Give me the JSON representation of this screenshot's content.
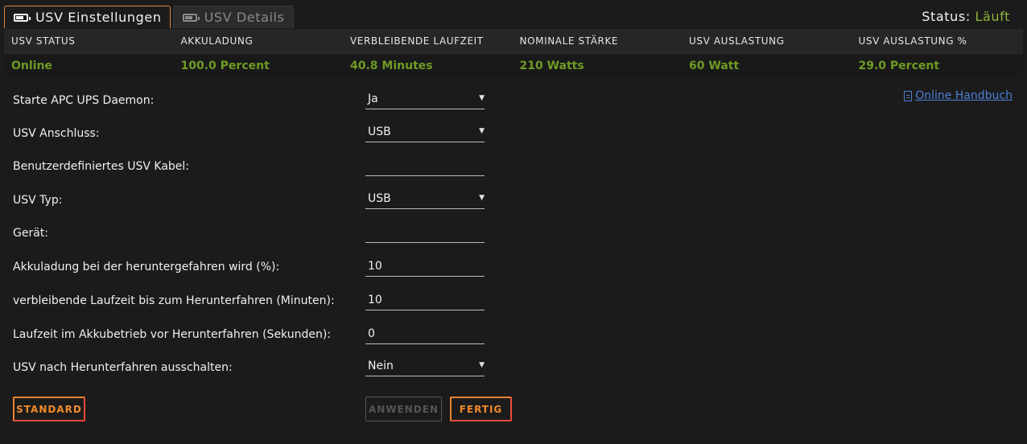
{
  "tabs": [
    {
      "label": "USV Einstellungen",
      "icon": "battery-icon",
      "active": true
    },
    {
      "label": "USV Details",
      "icon": "battery-icon",
      "active": false
    }
  ],
  "status": {
    "label": "Status:",
    "value": "Läuft",
    "value_color": "#8cb53a"
  },
  "summary": {
    "headers": [
      "USV STATUS",
      "AKKULADUNG",
      "VERBLEIBENDE LAUFZEIT",
      "NOMINALE STÄRKE",
      "USV AUSLASTUNG",
      "USV AUSLASTUNG %"
    ],
    "values": [
      "Online",
      "100.0 Percent",
      "40.8 Minutes",
      "210 Watts",
      "60 Watt",
      "29.0 Percent"
    ],
    "value_color": "#6f9a25"
  },
  "manual_link": "Online Handbuch",
  "form": [
    {
      "label": "Starte APC UPS Daemon:",
      "value": "Ja",
      "type": "select"
    },
    {
      "label": "USV Anschluss:",
      "value": "USB",
      "type": "select"
    },
    {
      "label": "Benutzerdefiniertes USV Kabel:",
      "value": "",
      "type": "text"
    },
    {
      "label": "USV Typ:",
      "value": "USB",
      "type": "select"
    },
    {
      "label": "Gerät:",
      "value": "",
      "type": "text"
    },
    {
      "label": "Akkuladung bei der heruntergefahren wird (%):",
      "value": "10",
      "type": "text"
    },
    {
      "label": "verbleibende Laufzeit bis zum Herunterfahren (Minuten):",
      "value": "10",
      "type": "text"
    },
    {
      "label": "Laufzeit im Akkubetrieb vor Herunterfahren (Sekunden):",
      "value": "0",
      "type": "text"
    },
    {
      "label": "USV nach Herunterfahren ausschalten:",
      "value": "Nein",
      "type": "select"
    }
  ],
  "buttons": {
    "standard": "STANDARD",
    "apply": "ANWENDEN",
    "done": "FERTIG"
  },
  "colors": {
    "accent": "#e8843a",
    "button_border_right": "#ee4b3a",
    "link": "#4d7fd6",
    "background": "#1c1b1b"
  }
}
